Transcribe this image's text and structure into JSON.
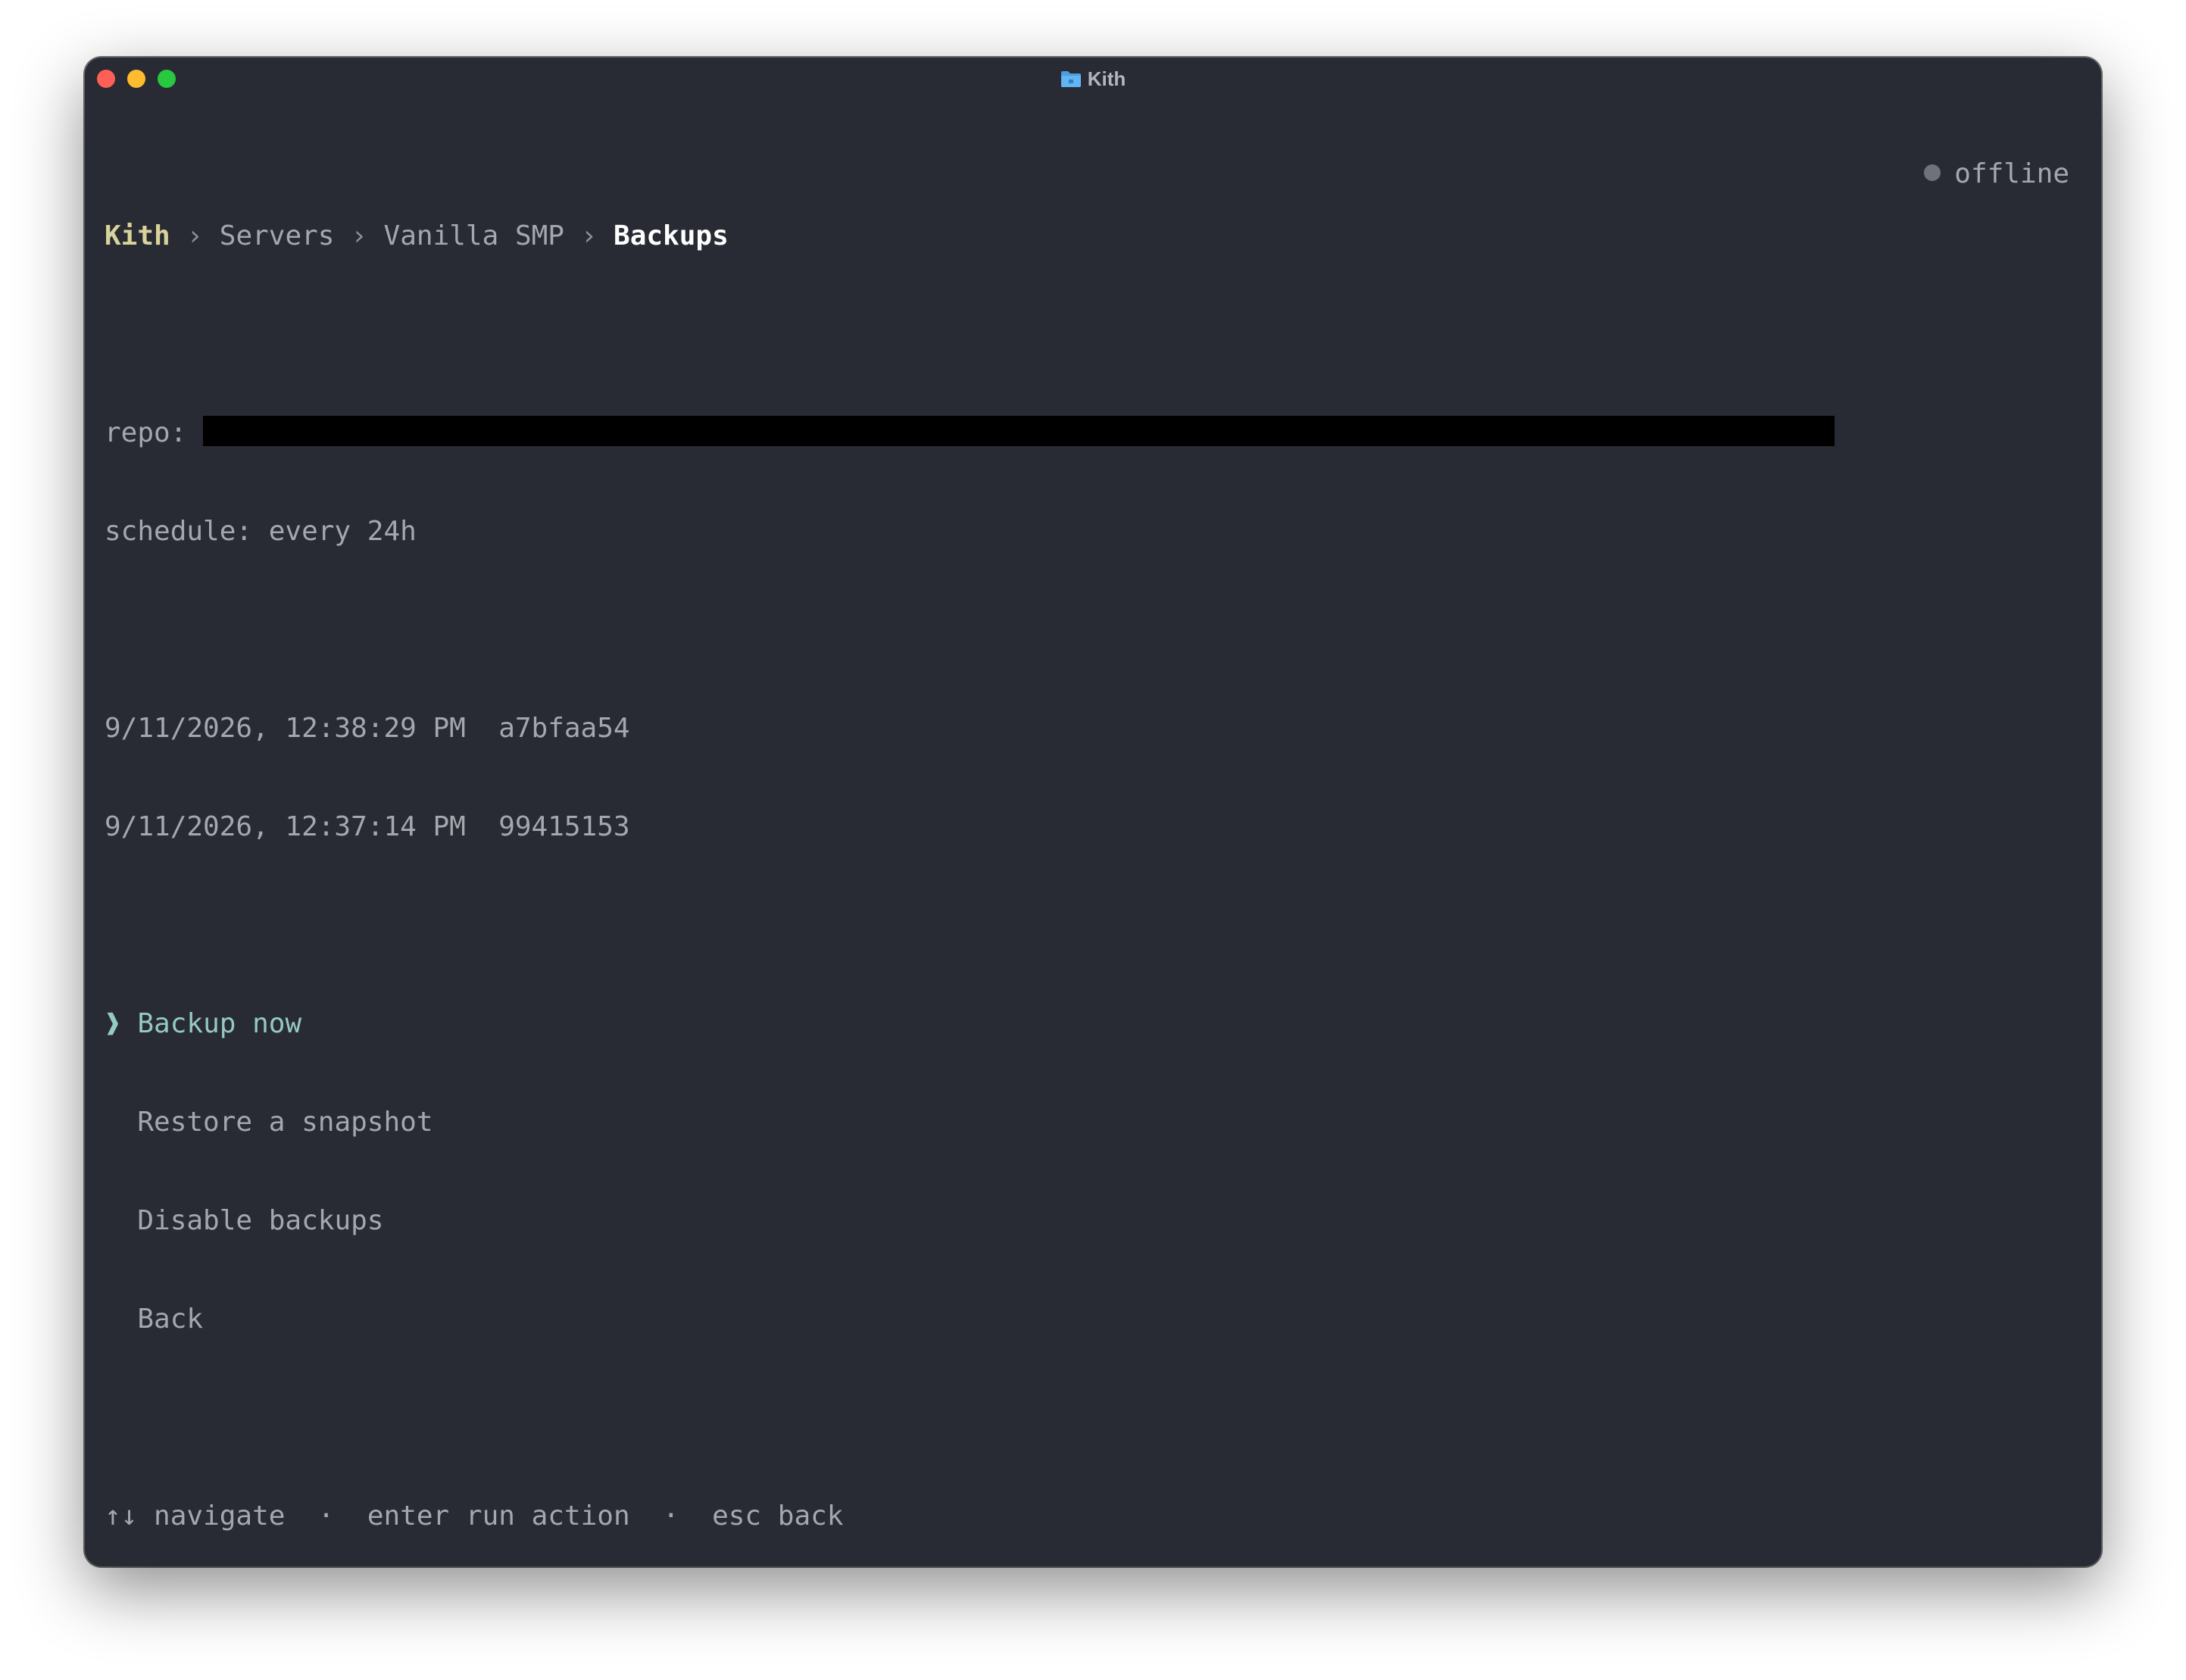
{
  "window": {
    "title": "Kith",
    "title_icon": "folder-icon"
  },
  "breadcrumb": {
    "root": "Kith",
    "separator": "›",
    "items": [
      "Servers",
      "Vanilla SMP"
    ],
    "current": "Backups"
  },
  "status": {
    "label": "offline",
    "dot_color": "#6f7279"
  },
  "info": {
    "repo_label": "repo:",
    "schedule": "schedule: every 24h"
  },
  "snapshots": [
    {
      "timestamp": "9/11/2026, 12:38:29 PM",
      "id": "a7bfaa54"
    },
    {
      "timestamp": "9/11/2026, 12:37:14 PM",
      "id": "99415153"
    }
  ],
  "menu": {
    "cursor": "❱",
    "items": [
      "Backup now",
      "Restore a snapshot",
      "Disable backups",
      "Back"
    ],
    "selected_index": 0
  },
  "help": {
    "arrows": "↑↓",
    "navigate": "navigate",
    "sep": "·",
    "enter_key": "enter",
    "enter_action": "run action",
    "esc_key": "esc",
    "esc_action": "back"
  },
  "colors": {
    "background": "#282b33",
    "accent": "#95c9c2",
    "root_crumb": "#d7d39a"
  }
}
